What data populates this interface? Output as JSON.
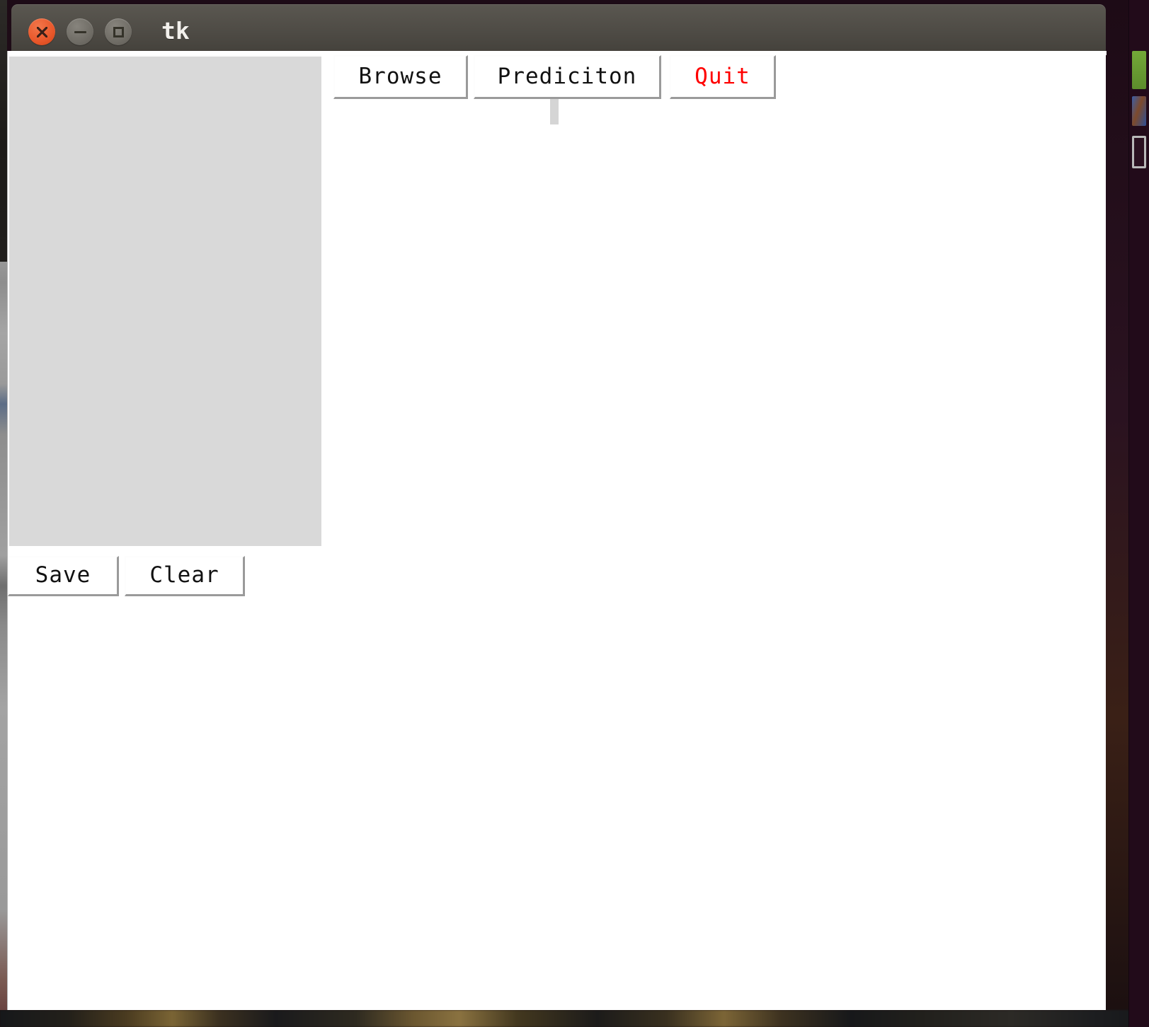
{
  "window": {
    "title": "tk",
    "controls": [
      {
        "name": "close",
        "icon": "close-icon",
        "color": "#e8572a"
      },
      {
        "name": "minimize",
        "icon": "minimize-icon",
        "color": "#706d66"
      },
      {
        "name": "maximize",
        "icon": "maximize-icon",
        "color": "#706d66"
      }
    ],
    "titlebar_color": "#4f4c46"
  },
  "toolbar": {
    "browse_label": "Browse",
    "prediction_label": "Prediciton",
    "quit_label": "Quit",
    "quit_color": "#ff0000"
  },
  "panel": {
    "canvas_color": "#d9d9d9",
    "save_label": "Save",
    "clear_label": "Clear"
  },
  "desktop": {
    "launcher_color": "#220b1a",
    "launcher_icons": [
      "green-app-icon",
      "blue-app-icon",
      "bordered-square-icon"
    ]
  }
}
